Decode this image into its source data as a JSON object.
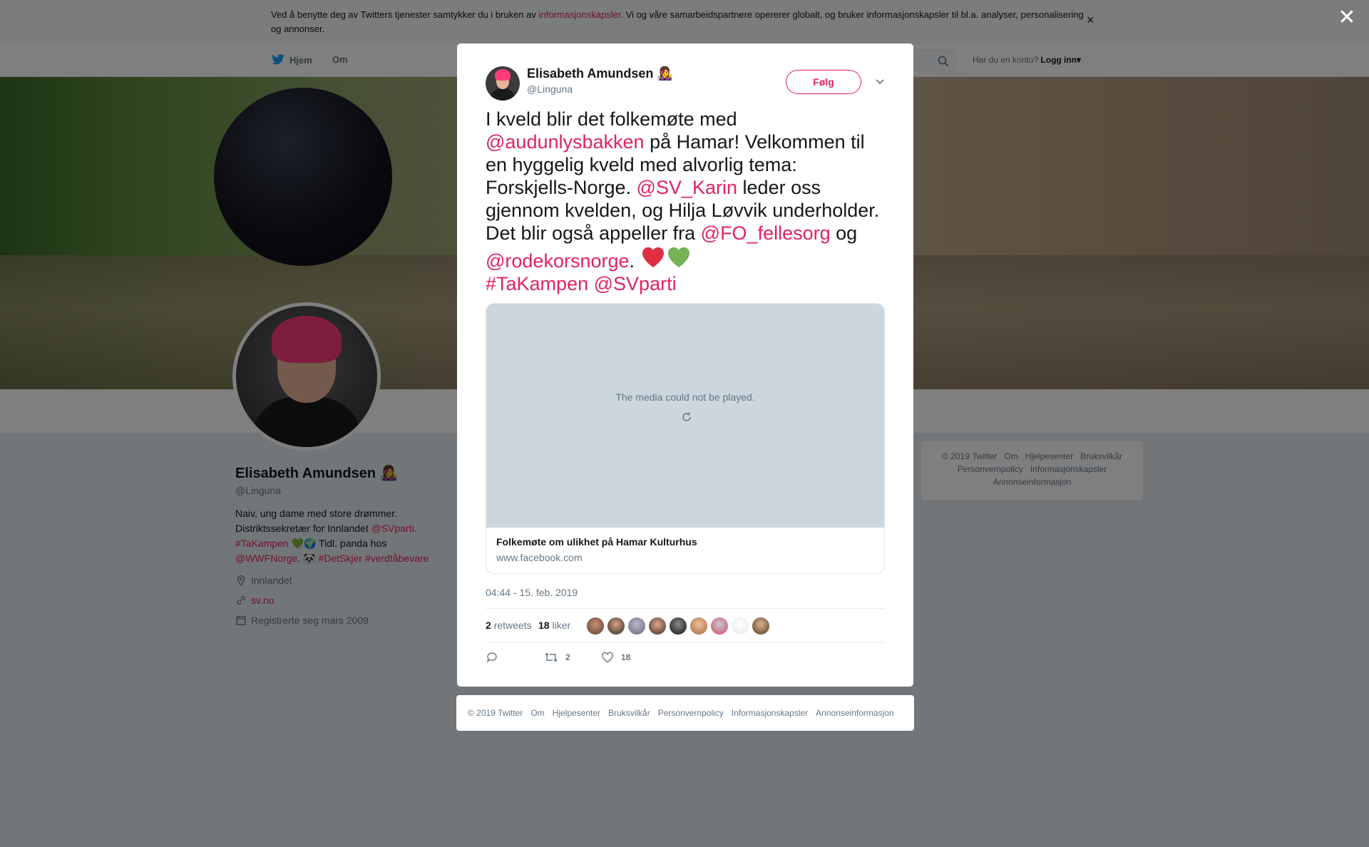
{
  "cookie": {
    "text_before": "Ved å benytte deg av Twitters tjenester samtykker du i bruken av ",
    "link": "informasjonskapsler",
    "text_after": ". Vi og våre samarbeidspartnere opererer globalt, og bruker informasjonskapsler til bl.a. analyser, personalisering og annonser.",
    "close": "×"
  },
  "nav": {
    "home": "Hjem",
    "about": "Om",
    "login_prompt": "Har du en konto?",
    "login": "Logg inn▾"
  },
  "profile": {
    "name": "Elisabeth Amundsen 👩‍🎤",
    "handle": "@Linguna",
    "bio": {
      "line1": "Naiv, ung dame med store drømmer.",
      "line2a": "Distriktssekretær for Innlandet ",
      "line2_link": "@SVparti",
      "line2b": ".",
      "line3_link": "#TaKampen",
      "line3_emoji": " 💚🌍 ",
      "line3b": "Tidl. panda hos",
      "line4_link1": "@WWFNorge",
      "line4_mid": ". 🐼 ",
      "line4_link2": "#DetSkjer",
      "line4_link3": "#verdtåbevare"
    },
    "location": "Innlandet",
    "website": "sv.no",
    "joined": "Registrerte seg mars 2009"
  },
  "side_footer": [
    "© 2019 Twitter",
    "Om",
    "Hjelpesenter",
    "Bruksvilkår",
    "Personvernpolicy",
    "Informasjonskapsler",
    "Annonseinformasjon"
  ],
  "close_icon": "✕",
  "tweet": {
    "author_name": "Elisabeth Amundsen 👩‍🎤",
    "author_handle": "@Linguna",
    "follow": "Følg",
    "text": {
      "p1": "I kveld blir det folkemøte med ",
      "m1": "@audunlysbakken",
      "p2": " på Hamar! Velkommen til en hyggelig kveld med alvorlig tema: Forskjells-Norge. ",
      "m2": "@SV_Karin",
      "p3": " leder oss gjennom kvelden, og Hilja Løvvik underholder. Det blir også appeller fra ",
      "m3": "@FO_fellesorg",
      "p4": " og ",
      "m4": "@rodekorsnorge",
      "p5": ". ",
      "h1": "#TaKampen",
      "m5": "@SVparti"
    },
    "media_message": "The media could not be played.",
    "card_title": "Folkemøte om ulikhet på Hamar Kulturhus",
    "card_url": "www.facebook.com",
    "timestamp": "04:44 - 15. feb. 2019",
    "retweets": "2",
    "retweets_label": "retweets",
    "likes": "18",
    "likes_label": "liker",
    "retweet_count": "2",
    "like_count": "18",
    "colors": {
      "accent": "#e0245e",
      "heart_red": "#dd2e44",
      "heart_green": "#77b255"
    }
  },
  "modal_footer": [
    "© 2019 Twitter",
    "Om",
    "Hjelpesenter",
    "Bruksvilkår",
    "Personvernpolicy",
    "Informasjonskapsler",
    "Annonseinformasjon"
  ]
}
